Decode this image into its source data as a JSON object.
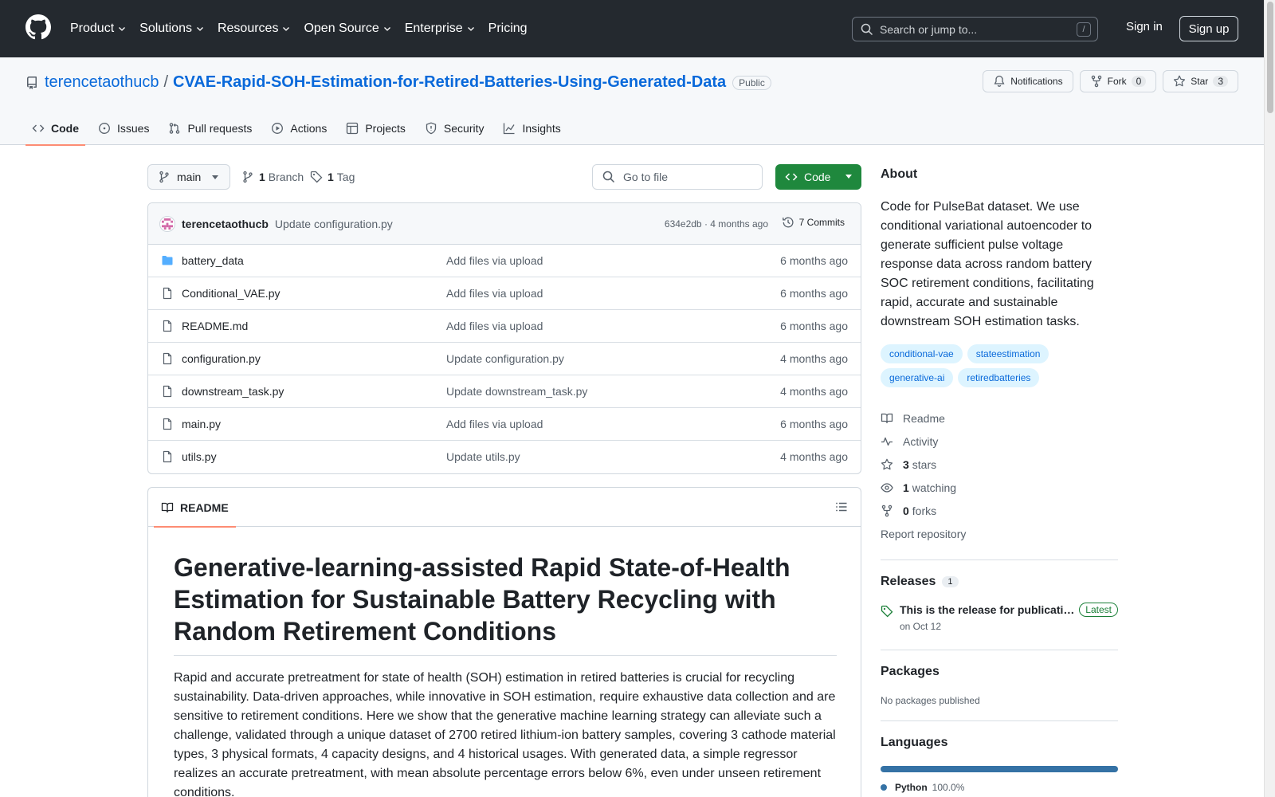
{
  "header": {
    "nav": [
      {
        "label": "Product",
        "chevron": true
      },
      {
        "label": "Solutions",
        "chevron": true
      },
      {
        "label": "Resources",
        "chevron": true
      },
      {
        "label": "Open Source",
        "chevron": true
      },
      {
        "label": "Enterprise",
        "chevron": true
      },
      {
        "label": "Pricing",
        "chevron": false
      }
    ],
    "search_placeholder": "Search or jump to...",
    "search_shortcut": "/",
    "signin": "Sign in",
    "signup": "Sign up"
  },
  "repo": {
    "owner": "terencetaothucb",
    "separator": "/",
    "name": "CVAE-Rapid-SOH-Estimation-for-Retired-Batteries-Using-Generated-Data",
    "visibility": "Public",
    "notifications": "Notifications",
    "fork_label": "Fork",
    "fork_count": "0",
    "star_label": "Star",
    "star_count": "3"
  },
  "tabs": [
    "Code",
    "Issues",
    "Pull requests",
    "Actions",
    "Projects",
    "Security",
    "Insights"
  ],
  "toolbar": {
    "branch": "main",
    "branch_count": "1",
    "branch_label": "Branch",
    "tag_count": "1",
    "tag_label": "Tag",
    "goto_file": "Go to file",
    "code_button": "Code"
  },
  "commit": {
    "author": "terencetaothucb",
    "message": "Update configuration.py",
    "hash_time": "634e2db · 4 months ago",
    "commits": "7 Commits"
  },
  "files": [
    {
      "name": "battery_data",
      "type": "dir",
      "message": "Add files via upload",
      "date": "6 months ago"
    },
    {
      "name": "Conditional_VAE.py",
      "type": "file",
      "message": "Add files via upload",
      "date": "6 months ago"
    },
    {
      "name": "README.md",
      "type": "file",
      "message": "Add files via upload",
      "date": "6 months ago"
    },
    {
      "name": "configuration.py",
      "type": "file",
      "message": "Update configuration.py",
      "date": "4 months ago"
    },
    {
      "name": "downstream_task.py",
      "type": "file",
      "message": "Update downstream_task.py",
      "date": "4 months ago"
    },
    {
      "name": "main.py",
      "type": "file",
      "message": "Add files via upload",
      "date": "6 months ago"
    },
    {
      "name": "utils.py",
      "type": "file",
      "message": "Update utils.py",
      "date": "4 months ago"
    }
  ],
  "readme": {
    "tab": "README",
    "title": "Generative-learning-assisted Rapid State-of-Health Estimation for Sustainable Battery Recycling with Random Retirement Conditions",
    "paragraph": "Rapid and accurate pretreatment for state of health (SOH) estimation in retired batteries is crucial for recycling sustainability. Data-driven approaches, while innovative in SOH estimation, require exhaustive data collection and are sensitive to retirement conditions. Here we show that the generative machine learning strategy can alleviate such a challenge, validated through a unique dataset of 2700 retired lithium-ion battery samples, covering 3 cathode material types, 3 physical formats, 4 capacity designs, and 4 historical usages. With generated data, a simple regressor realizes an accurate pretreatment, with mean absolute percentage errors below 6%, even under unseen retirement conditions."
  },
  "sidebar": {
    "about_title": "About",
    "about": "Code for PulseBat dataset. We use conditional variational autoencoder to generate sufficient pulse voltage response data across random battery SOC retirement conditions, facilitating rapid, accurate and sustainable downstream SOH estimation tasks.",
    "topics": [
      "conditional-vae",
      "stateestimation",
      "generative-ai",
      "retiredbatteries"
    ],
    "links": {
      "readme": "Readme",
      "activity": "Activity",
      "stars_count": "3",
      "stars_label": "stars",
      "watching_count": "1",
      "watching_label": "watching",
      "forks_count": "0",
      "forks_label": "forks",
      "report": "Report repository"
    },
    "releases_title": "Releases",
    "releases_count": "1",
    "release_name": "This is the release for publication",
    "release_latest": "Latest",
    "release_date": "on Oct 12",
    "packages_title": "Packages",
    "packages_none": "No packages published",
    "languages_title": "Languages",
    "language_name": "Python",
    "language_pct": "100.0%",
    "language_color": "#3572A5"
  }
}
